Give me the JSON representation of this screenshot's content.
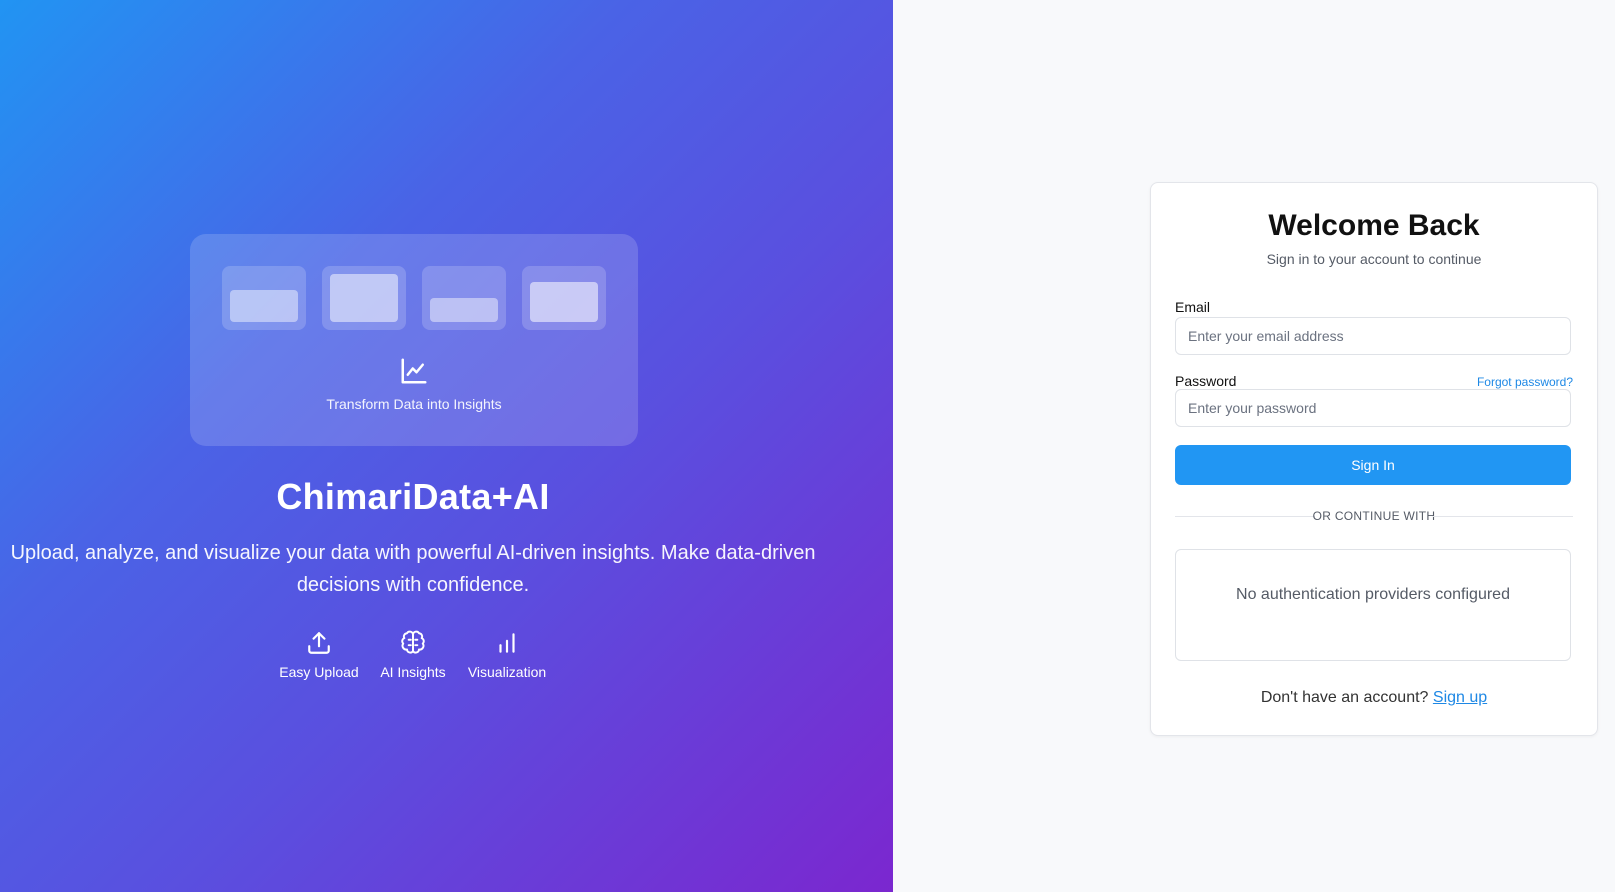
{
  "hero": {
    "illustration_caption": "Transform Data into Insights",
    "brand": "ChimariData+AI",
    "tagline": "Upload, analyze, and visualize your data with powerful AI-driven insights. Make data-driven decisions with confidence.",
    "features": [
      {
        "label": "Easy Upload",
        "icon": "upload-icon"
      },
      {
        "label": "AI Insights",
        "icon": "brain-icon"
      },
      {
        "label": "Visualization",
        "icon": "bar-chart-icon"
      }
    ],
    "gradient_colors": [
      "#2194f3",
      "#4a63e6",
      "#5a4fdf",
      "#7b27cf"
    ]
  },
  "login": {
    "title": "Welcome Back",
    "subtitle": "Sign in to your account to continue",
    "email_label": "Email",
    "email_placeholder": "Enter your email address",
    "password_label": "Password",
    "forgot_password": "Forgot password?",
    "password_placeholder": "Enter your password",
    "submit_label": "Sign In",
    "divider_text": "OR CONTINUE WITH",
    "providers_empty": "No authentication providers configured",
    "signup_prompt": "Don't have an account?",
    "signup_link": "Sign up",
    "accent_color": "#2196f3"
  }
}
